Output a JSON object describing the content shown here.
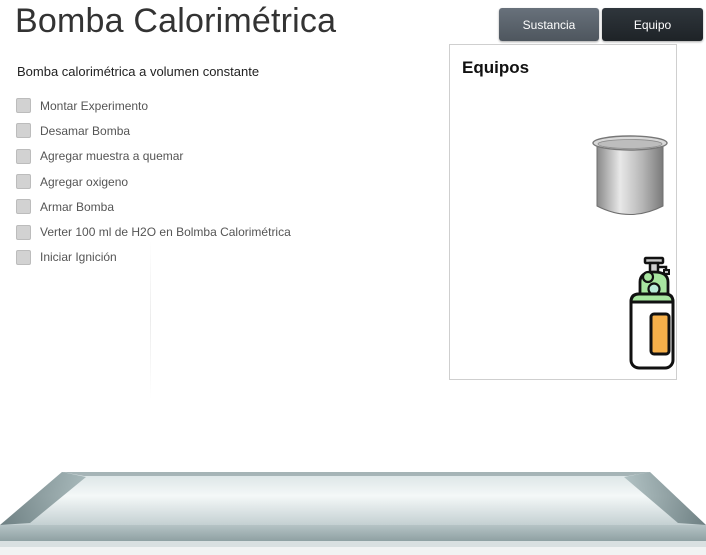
{
  "header": {
    "title": "Bomba Calorimétrica"
  },
  "tabs": [
    {
      "label": "Sustancia"
    },
    {
      "label": "Equipo"
    }
  ],
  "procedure": {
    "title": "Bomba calorimétrica a volumen constante",
    "steps": [
      {
        "label": "Montar Experimento"
      },
      {
        "label": "Desamar Bomba"
      },
      {
        "label": "Agregar muestra a quemar"
      },
      {
        "label": "Agregar oxigeno"
      },
      {
        "label": "Armar Bomba"
      },
      {
        "label": "Verter  100 ml  de H2O en Bolmba Calorimétrica"
      },
      {
        "label": "Iniciar Ignición"
      }
    ]
  },
  "equipment_panel": {
    "title": "Equipos",
    "items": [
      {
        "icon": "calorimeter-bucket-icon"
      },
      {
        "icon": "oxygen-cylinder-icon"
      }
    ]
  },
  "colors": {
    "tab_inactive": "#5c646c",
    "tab_active": "#262b30",
    "cylinder_green": "#a8e6a0",
    "cylinder_orange": "#f6b04a"
  }
}
